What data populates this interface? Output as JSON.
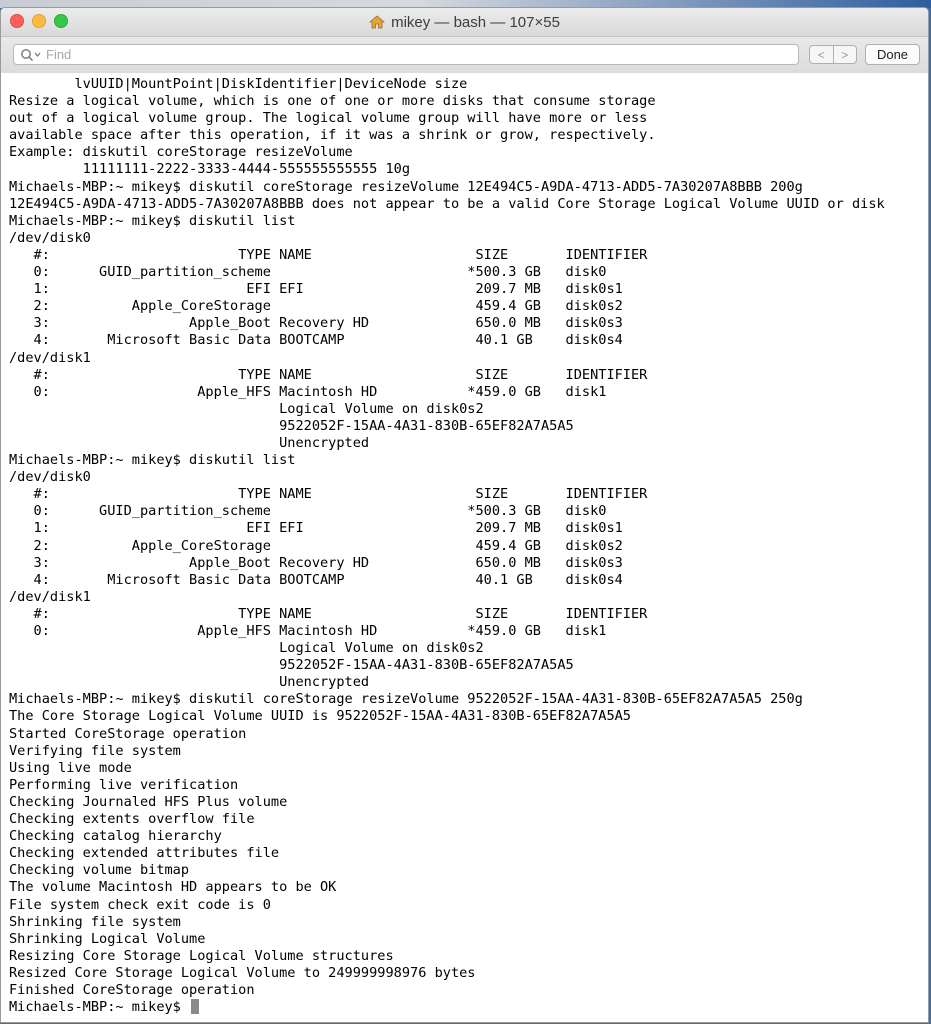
{
  "window": {
    "title": "mikey — bash — 107×55"
  },
  "findbar": {
    "placeholder": "Find",
    "prev_label": "<",
    "next_label": ">",
    "done_label": "Done"
  },
  "terminal": {
    "lines": [
      "        lvUUID|MountPoint|DiskIdentifier|DeviceNode size",
      "Resize a logical volume, which is one of one or more disks that consume storage",
      "out of a logical volume group. The logical volume group will have more or less",
      "available space after this operation, if it was a shrink or grow, respectively.",
      "Example: diskutil coreStorage resizeVolume",
      "         11111111-2222-3333-4444-555555555555 10g",
      "Michaels-MBP:~ mikey$ diskutil coreStorage resizeVolume 12E494C5-A9DA-4713-ADD5-7A30207A8BBB 200g",
      "12E494C5-A9DA-4713-ADD5-7A30207A8BBB does not appear to be a valid Core Storage Logical Volume UUID or disk",
      "Michaels-MBP:~ mikey$ diskutil list",
      "/dev/disk0",
      "   #:                       TYPE NAME                    SIZE       IDENTIFIER",
      "   0:      GUID_partition_scheme                        *500.3 GB   disk0",
      "   1:                        EFI EFI                     209.7 MB   disk0s1",
      "   2:          Apple_CoreStorage                         459.4 GB   disk0s2",
      "   3:                 Apple_Boot Recovery HD             650.0 MB   disk0s3",
      "   4:       Microsoft Basic Data BOOTCAMP                40.1 GB    disk0s4",
      "/dev/disk1",
      "   #:                       TYPE NAME                    SIZE       IDENTIFIER",
      "   0:                  Apple_HFS Macintosh HD           *459.0 GB   disk1",
      "                                 Logical Volume on disk0s2",
      "                                 9522052F-15AA-4A31-830B-65EF82A7A5A5",
      "                                 Unencrypted",
      "Michaels-MBP:~ mikey$ diskutil list",
      "/dev/disk0",
      "   #:                       TYPE NAME                    SIZE       IDENTIFIER",
      "   0:      GUID_partition_scheme                        *500.3 GB   disk0",
      "   1:                        EFI EFI                     209.7 MB   disk0s1",
      "   2:          Apple_CoreStorage                         459.4 GB   disk0s2",
      "   3:                 Apple_Boot Recovery HD             650.0 MB   disk0s3",
      "   4:       Microsoft Basic Data BOOTCAMP                40.1 GB    disk0s4",
      "/dev/disk1",
      "   #:                       TYPE NAME                    SIZE       IDENTIFIER",
      "   0:                  Apple_HFS Macintosh HD           *459.0 GB   disk1",
      "                                 Logical Volume on disk0s2",
      "                                 9522052F-15AA-4A31-830B-65EF82A7A5A5",
      "                                 Unencrypted",
      "Michaels-MBP:~ mikey$ diskutil coreStorage resizeVolume 9522052F-15AA-4A31-830B-65EF82A7A5A5 250g",
      "The Core Storage Logical Volume UUID is 9522052F-15AA-4A31-830B-65EF82A7A5A5",
      "Started CoreStorage operation",
      "Verifying file system",
      "Using live mode",
      "Performing live verification",
      "Checking Journaled HFS Plus volume",
      "Checking extents overflow file",
      "Checking catalog hierarchy",
      "Checking extended attributes file",
      "Checking volume bitmap",
      "The volume Macintosh HD appears to be OK",
      "File system check exit code is 0",
      "Shrinking file system",
      "Shrinking Logical Volume",
      "Resizing Core Storage Logical Volume structures",
      "Resized Core Storage Logical Volume to 249999998976 bytes",
      "Finished CoreStorage operation"
    ],
    "prompt": "Michaels-MBP:~ mikey$ "
  }
}
